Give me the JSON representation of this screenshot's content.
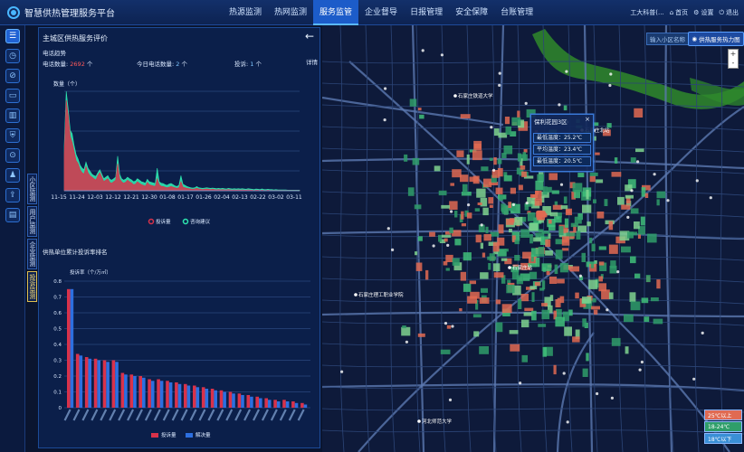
{
  "app": {
    "title": "智慧供热管理服务平台"
  },
  "nav": {
    "items": [
      "热源监测",
      "热网监测",
      "服务监管",
      "企业督导",
      "日报管理",
      "安全保障",
      "台账管理"
    ],
    "active_index": 2
  },
  "topbar": {
    "user": "工大科普(...",
    "home": "首页",
    "settings": "设置",
    "logout": "退出"
  },
  "vertical_tabs": [
    "小区监测",
    "用户监测",
    "企业监测",
    "投诉监测"
  ],
  "panel": {
    "title": "主城区供热服务评价",
    "calls_section": "电话趋势",
    "calls_label": "电话数量:",
    "calls_value": "2692",
    "unit": "个",
    "today_label": "今日电话数量:",
    "today_value": "2",
    "complaint_label": "投诉:",
    "complaint_value": "1",
    "details": "详情",
    "ranking_title": "供热单位累计投诉率排名"
  },
  "chart_data": [
    {
      "type": "area",
      "ylabel": "数量（个）",
      "x_tick_labels": [
        "11-15",
        "11-24",
        "12-03",
        "12-12",
        "12-21",
        "12-30",
        "01-08",
        "01-17",
        "01-26",
        "02-04",
        "02-13",
        "02-22",
        "03-02",
        "03-11"
      ],
      "grid": true,
      "legend": "bottom",
      "series": [
        {
          "name": "投诉量",
          "color": "#d9324a",
          "values": [
            120,
            300,
            250,
            180,
            160,
            130,
            100,
            90,
            70,
            60,
            55,
            80,
            60,
            50,
            45,
            40,
            35,
            50,
            60,
            45,
            30,
            35,
            40,
            28,
            25,
            30,
            35,
            90,
            40,
            30,
            25,
            28,
            35,
            30,
            26,
            20,
            22,
            30,
            25,
            20,
            18,
            15,
            28,
            20,
            18,
            16,
            14,
            40,
            20,
            15,
            14,
            12,
            10,
            12,
            14,
            12,
            10,
            8,
            10,
            30,
            12,
            10,
            8,
            7,
            6,
            5,
            6,
            8,
            6,
            5,
            4,
            5,
            6,
            5,
            4,
            5,
            4,
            3,
            4,
            3,
            4,
            3,
            3,
            4,
            3,
            2,
            3,
            2,
            3,
            2,
            3,
            2,
            2,
            3,
            2,
            2,
            1,
            2,
            2,
            1,
            2,
            1,
            1,
            2,
            1,
            1,
            1,
            1,
            1,
            1,
            1,
            1,
            1,
            1,
            1,
            1,
            1,
            1,
            1,
            1
          ]
        },
        {
          "name": "咨询建议",
          "color": "#2ee6b0",
          "values": [
            150,
            330,
            270,
            200,
            190,
            150,
            120,
            105,
            85,
            75,
            70,
            95,
            75,
            65,
            55,
            50,
            48,
            60,
            70,
            55,
            40,
            45,
            50,
            38,
            35,
            40,
            45,
            115,
            55,
            40,
            35,
            38,
            45,
            40,
            36,
            30,
            32,
            40,
            35,
            30,
            28,
            25,
            38,
            30,
            28,
            26,
            24,
            75,
            30,
            25,
            24,
            20,
            18,
            22,
            24,
            20,
            16,
            14,
            18,
            50,
            22,
            18,
            14,
            12,
            10,
            9,
            10,
            14,
            10,
            9,
            8,
            9,
            10,
            9,
            8,
            9,
            8,
            7,
            8,
            7,
            8,
            7,
            6,
            8,
            7,
            6,
            7,
            6,
            7,
            6,
            7,
            6,
            5,
            7,
            6,
            5,
            4,
            6,
            5,
            4,
            6,
            4,
            4,
            5,
            4,
            4,
            3,
            4,
            3,
            3,
            3,
            3,
            3,
            2,
            2,
            2,
            2,
            2,
            2,
            2
          ]
        }
      ]
    },
    {
      "type": "bar",
      "ylabel": "投诉率（个/万㎡）",
      "ylim": [
        0,
        0.8
      ],
      "yticks": [
        0,
        0.1,
        0.2,
        0.3,
        0.4,
        0.5,
        0.6,
        0.7,
        0.8
      ],
      "grid": true,
      "legend": "bottom",
      "series": [
        {
          "name": "投诉量",
          "color": "#d9324a",
          "values": [
            0.75,
            0.34,
            0.32,
            0.31,
            0.3,
            0.3,
            0.22,
            0.21,
            0.2,
            0.18,
            0.18,
            0.17,
            0.16,
            0.15,
            0.14,
            0.13,
            0.12,
            0.11,
            0.1,
            0.09,
            0.08,
            0.07,
            0.06,
            0.05,
            0.05,
            0.04,
            0.03
          ]
        },
        {
          "name": "解决量",
          "color": "#2d6fe0",
          "values": [
            0.75,
            0.33,
            0.31,
            0.3,
            0.29,
            0.29,
            0.21,
            0.2,
            0.19,
            0.17,
            0.17,
            0.16,
            0.15,
            0.14,
            0.13,
            0.12,
            0.11,
            0.1,
            0.09,
            0.08,
            0.07,
            0.06,
            0.05,
            0.04,
            0.04,
            0.03,
            0.02
          ]
        }
      ]
    }
  ],
  "map": {
    "search_placeholder": "输入小区名称",
    "heatmap_button": "供热服务热力图",
    "zoom_in": "+",
    "zoom_out": "-",
    "popup": {
      "title": "保利花园3区",
      "rows": [
        "最低温度：25.2℃",
        "平均温度：23.4℃",
        "最低温度：20.5℃"
      ]
    },
    "legend": [
      {
        "label": "25℃以上",
        "color": "#e06a52"
      },
      {
        "label": "18-24℃",
        "color": "#2f9e6a"
      },
      {
        "label": "18℃以下",
        "color": "#3a8fd6"
      }
    ],
    "labels": [
      "石家庄铁道大学",
      "石家庄北站",
      "石家庄站",
      "石家庄理工职业学院",
      "河北师范大学"
    ]
  }
}
